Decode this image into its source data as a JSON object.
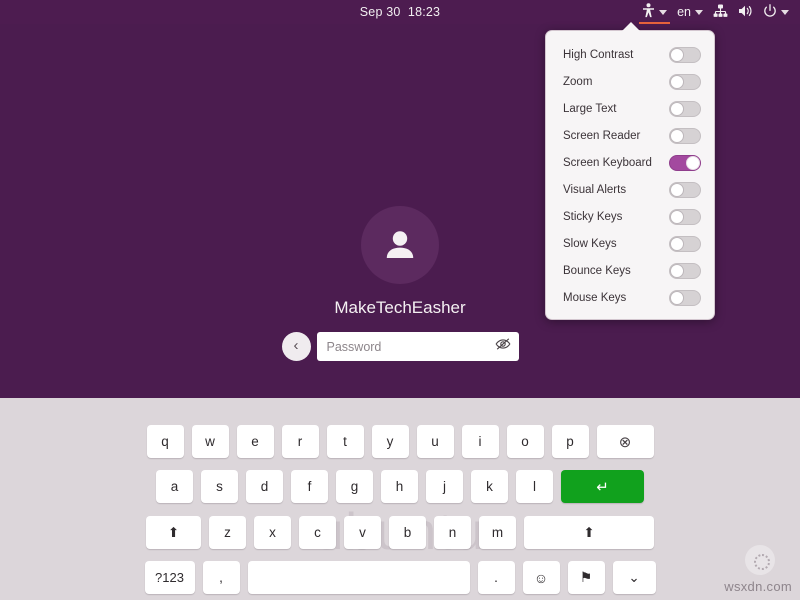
{
  "topbar": {
    "clock": "Sep 30  18:23",
    "accessibility_icon": "accessibility-icon",
    "language": "en",
    "network_icon": "wired-network-icon",
    "volume_icon": "volume-icon",
    "power_icon": "power-icon"
  },
  "a11y_menu": {
    "items": [
      {
        "label": "High Contrast",
        "enabled": false
      },
      {
        "label": "Zoom",
        "enabled": false
      },
      {
        "label": "Large Text",
        "enabled": false
      },
      {
        "label": "Screen Reader",
        "enabled": false
      },
      {
        "label": "Screen Keyboard",
        "enabled": true
      },
      {
        "label": "Visual Alerts",
        "enabled": false
      },
      {
        "label": "Sticky Keys",
        "enabled": false
      },
      {
        "label": "Slow Keys",
        "enabled": false
      },
      {
        "label": "Bounce Keys",
        "enabled": false
      },
      {
        "label": "Mouse Keys",
        "enabled": false
      }
    ]
  },
  "login": {
    "username": "MakeTechEasher",
    "password_placeholder": "Password",
    "back_label": "‹",
    "reveal_icon": "eye-slash-icon"
  },
  "keyboard": {
    "row1": [
      "q",
      "w",
      "e",
      "r",
      "t",
      "y",
      "u",
      "i",
      "o",
      "p"
    ],
    "row1_backspace": "⊗",
    "row2": [
      "a",
      "s",
      "d",
      "f",
      "g",
      "h",
      "j",
      "k",
      "l"
    ],
    "row2_enter": "↵",
    "row3_shift_left": "⬆",
    "row3": [
      "z",
      "x",
      "c",
      "v",
      "b",
      "n",
      "m"
    ],
    "row3_shift_right": "⬆",
    "row4_symbols": "?123",
    "row4_comma": ",",
    "row4_space": "",
    "row4_period": ".",
    "row4_emoji": "☺",
    "row4_flag": "⚑",
    "row4_hide": "⌄"
  },
  "watermarks": {
    "ubuntu": "ubuntu",
    "site": "wsxdn.com"
  },
  "colors": {
    "background": "#4b1c4f",
    "topbar": "#4d1c50",
    "accent_orange": "#e8643c",
    "toggle_on": "#a3499f",
    "enter_green": "#11a11d",
    "keyboard_bg": "#dcd6da"
  }
}
